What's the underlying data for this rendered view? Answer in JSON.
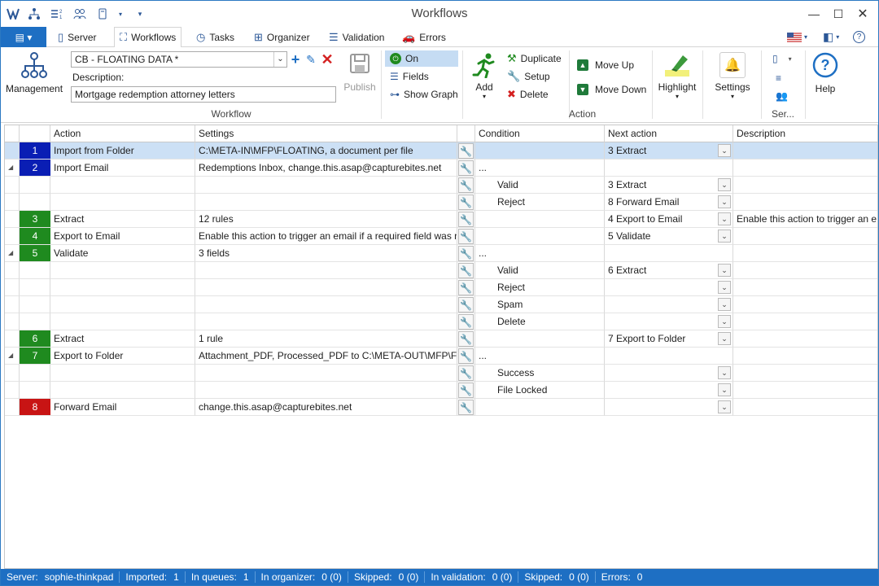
{
  "window": {
    "title": "Workflows"
  },
  "tabs": {
    "file_icon": "menu-icon",
    "items": [
      {
        "label": "Server",
        "icon": "server-icon"
      },
      {
        "label": "Workflows",
        "icon": "workflow-icon"
      },
      {
        "label": "Tasks",
        "icon": "clock-icon"
      },
      {
        "label": "Organizer",
        "icon": "grid-icon"
      },
      {
        "label": "Validation",
        "icon": "list-icon"
      },
      {
        "label": "Errors",
        "icon": "car-icon"
      }
    ]
  },
  "ribbon": {
    "management_label": "Management",
    "workflow_name": "CB - FLOATING DATA *",
    "description_label": "Description:",
    "description_value": "Mortgage redemption attorney letters",
    "publish_label": "Publish",
    "on_label": "On",
    "fields_label": "Fields",
    "show_graph_label": "Show Graph",
    "workflow_group_label": "Workflow",
    "add_label": "Add",
    "duplicate_label": "Duplicate",
    "setup_label": "Setup",
    "delete_label": "Delete",
    "move_up_label": "Move Up",
    "move_down_label": "Move  Down",
    "action_group_label": "Action",
    "highlight_label": "Highlight",
    "settings_label": "Settings",
    "ser_group_label": "Ser...",
    "help_label": "Help"
  },
  "grid": {
    "headers": {
      "action": "Action",
      "settings": "Settings",
      "condition": "Condition",
      "next_action": "Next action",
      "description": "Description"
    },
    "rows": [
      {
        "num": "1",
        "color": "#0a1eb4",
        "action": "Import from Folder",
        "settings": "C:\\META-IN\\MFP\\FLOATING, a document per file",
        "condition": "",
        "next": "3 Extract",
        "desc": "",
        "selected": true,
        "expand": false,
        "dd": true
      },
      {
        "num": "2",
        "color": "#0a1eb4",
        "action": "Import Email",
        "settings": "Redemptions Inbox, change.this.asap@capturebites.net",
        "condition": "...",
        "next": "",
        "desc": "",
        "expand": true,
        "dd": false
      },
      {
        "num": "",
        "action": "",
        "settings": "",
        "condition": "Valid",
        "next": "3 Extract",
        "desc": "",
        "sub": true,
        "dd": true
      },
      {
        "num": "",
        "action": "",
        "settings": "",
        "condition": "Reject",
        "next": "8 Forward Email",
        "desc": "",
        "sub": true,
        "dd": true
      },
      {
        "num": "3",
        "color": "#1f8a1f",
        "action": "Extract",
        "settings": "12 rules",
        "condition": "",
        "next": "4 Export to Email",
        "desc": "Enable this action to trigger an e...",
        "dd": true
      },
      {
        "num": "4",
        "color": "#1f8a1f",
        "action": "Export to Email",
        "settings": "Enable this action to trigger an email if a required field was not ...",
        "condition": "",
        "next": "5 Validate",
        "desc": "",
        "dd": true
      },
      {
        "num": "5",
        "color": "#1f8a1f",
        "action": "Validate",
        "settings": "3 fields",
        "condition": "...",
        "next": "",
        "desc": "",
        "expand": true,
        "dd": false
      },
      {
        "num": "",
        "action": "",
        "settings": "",
        "condition": "Valid",
        "next": "6 Extract",
        "desc": "",
        "sub": true,
        "dd": true
      },
      {
        "num": "",
        "action": "",
        "settings": "",
        "condition": "Reject",
        "next": "",
        "desc": "",
        "sub": true,
        "dd": true
      },
      {
        "num": "",
        "action": "",
        "settings": "",
        "condition": "Spam",
        "next": "",
        "desc": "",
        "sub": true,
        "dd": true
      },
      {
        "num": "",
        "action": "",
        "settings": "",
        "condition": "Delete",
        "next": "",
        "desc": "",
        "sub": true,
        "dd": true
      },
      {
        "num": "6",
        "color": "#1f8a1f",
        "action": "Extract",
        "settings": "1 rule",
        "condition": "",
        "next": "7 Export to Folder",
        "desc": "",
        "dd": true
      },
      {
        "num": "7",
        "color": "#1f8a1f",
        "action": "Export to Folder",
        "settings": "Attachment_PDF, Processed_PDF to C:\\META-OUT\\MFP\\FLOA...",
        "condition": "...",
        "next": "",
        "desc": "",
        "expand": true,
        "dd": false
      },
      {
        "num": "",
        "action": "",
        "settings": "",
        "condition": "Success",
        "next": "",
        "desc": "",
        "sub": true,
        "dd": true
      },
      {
        "num": "",
        "action": "",
        "settings": "",
        "condition": "File Locked",
        "next": "",
        "desc": "",
        "sub": true,
        "dd": true
      },
      {
        "num": "8",
        "color": "#c81414",
        "action": "Forward Email",
        "settings": "change.this.asap@capturebites.net",
        "condition": "",
        "next": "",
        "desc": "",
        "dd": true
      }
    ]
  },
  "status": [
    {
      "label": "Server:",
      "value": "sophie-thinkpad"
    },
    {
      "label": "Imported:",
      "value": "1"
    },
    {
      "label": "In queues:",
      "value": "1"
    },
    {
      "label": "In organizer:",
      "value": "0 (0)"
    },
    {
      "label": "Skipped:",
      "value": "0 (0)"
    },
    {
      "label": "In validation:",
      "value": "0 (0)"
    },
    {
      "label": "Skipped:",
      "value": "0 (0)"
    },
    {
      "label": "Errors:",
      "value": "0"
    }
  ]
}
